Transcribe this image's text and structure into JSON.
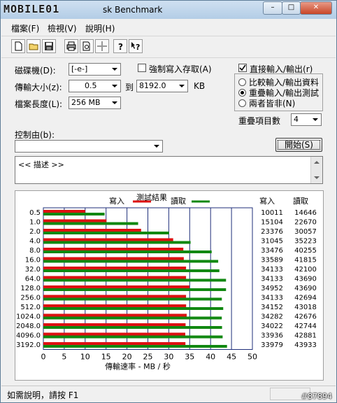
{
  "window": {
    "logo_text": "MOBILE01",
    "title": "sk Benchmark",
    "minimize": "–",
    "maximize": "□",
    "close": "✕"
  },
  "menu": {
    "file": "檔案(F)",
    "view": "檢視(V)",
    "help": "說明(H)"
  },
  "toolbar_icons": [
    "new-file-icon",
    "open-folder-icon",
    "save-icon",
    "print-icon",
    "print-preview-icon",
    "move-icon",
    "help-icon",
    "context-help-icon"
  ],
  "settings": {
    "drive_label": "磁碟機(D):",
    "drive_value": "[-e-]",
    "transfer_label": "傳輸大小(z):",
    "transfer_from": "0.5",
    "transfer_to_label": "到",
    "transfer_to": "8192.0",
    "transfer_unit": "KB",
    "file_length_label": "檔案長度(L):",
    "file_length": "256 MB",
    "force_write_label": "強制寫入存取(A)",
    "direct_io_label": "直接輸入/輸出(r)",
    "radio_compare": "比較輸入/輸出資料",
    "radio_overlap": "重疊輸入/輸出測試",
    "radio_neither": "兩者皆非(N)",
    "queue_label": "重疊項目數",
    "queue_value": "4",
    "controlled_by_label": "控制由(b):",
    "start_button": "開始(S)",
    "description": "<<    描述    >>"
  },
  "chart_data": {
    "type": "bar",
    "title": "測試結果",
    "legend": {
      "write": "寫入",
      "read": "讀取",
      "placement": "top"
    },
    "colors": {
      "write": "#dd1111",
      "read": "#118811",
      "grid": "#1f2f7a"
    },
    "xlabel": "傳輸速率 - MB / 秒",
    "xlim": [
      0,
      50
    ],
    "xticks": [
      "0",
      "5",
      "10",
      "15",
      "20",
      "25",
      "30",
      "35",
      "40",
      "45",
      "50"
    ],
    "categories": [
      "0.5",
      "1.0",
      "2.0",
      "4.0",
      "8.0",
      "16.0",
      "32.0",
      "64.0",
      "128.0",
      "256.0",
      "512.0",
      "1024.0",
      "2048.0",
      "4096.0",
      "3192.0"
    ],
    "col_headers": {
      "write": "寫入",
      "read": "讀取"
    },
    "write_kb": [
      "10011",
      "15104",
      "23376",
      "31045",
      "33476",
      "33589",
      "34133",
      "34133",
      "34952",
      "34133",
      "34152",
      "34282",
      "34022",
      "33936",
      "33979"
    ],
    "read_kb": [
      "14646",
      "22670",
      "30057",
      "35223",
      "40255",
      "41815",
      "42100",
      "43690",
      "43690",
      "42694",
      "43018",
      "42676",
      "42744",
      "42881",
      "43933"
    ],
    "write_mbs": [
      10.01,
      15.1,
      23.38,
      31.05,
      33.48,
      33.59,
      34.13,
      34.13,
      34.95,
      34.13,
      34.15,
      34.28,
      34.02,
      33.94,
      33.98
    ],
    "read_mbs": [
      14.65,
      22.67,
      30.06,
      35.22,
      40.26,
      41.82,
      42.1,
      43.69,
      43.69,
      42.69,
      43.02,
      42.68,
      42.74,
      42.88,
      43.93
    ]
  },
  "status": {
    "help_text": "如需說明，請按 F1",
    "watermark": "#87894"
  }
}
